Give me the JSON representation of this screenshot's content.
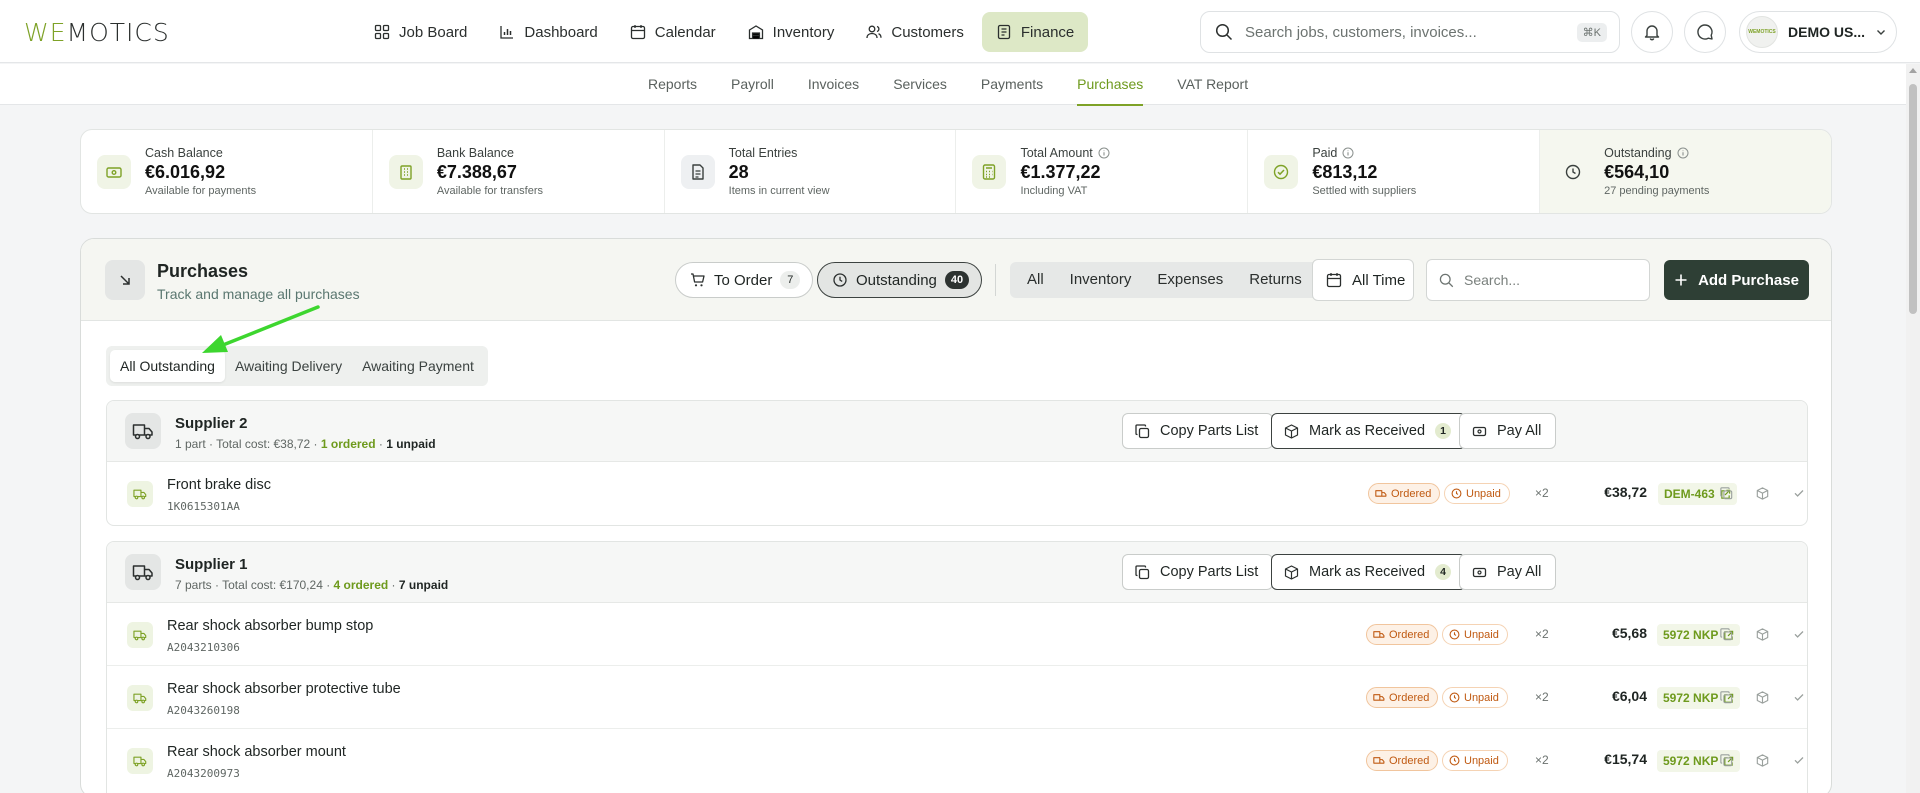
{
  "brand": {
    "logo_prefix": "WE",
    "logo_suffix": "MOTICS",
    "accent": "#7ea227",
    "dark_button": "#2e3f35"
  },
  "nav": {
    "items": [
      {
        "label": "Job Board",
        "icon": "grid-icon"
      },
      {
        "label": "Dashboard",
        "icon": "bar-chart-icon"
      },
      {
        "label": "Calendar",
        "icon": "calendar-icon"
      },
      {
        "label": "Inventory",
        "icon": "warehouse-icon"
      },
      {
        "label": "Customers",
        "icon": "users-icon"
      },
      {
        "label": "Finance",
        "icon": "receipt-icon",
        "active": true
      }
    ]
  },
  "search": {
    "placeholder": "Search jobs, customers, invoices...",
    "shortcut": "⌘K"
  },
  "user": {
    "name": "DEMO US...",
    "avatar_text": "WEMOTICS"
  },
  "subnav": {
    "items": [
      "Reports",
      "Payroll",
      "Invoices",
      "Services",
      "Payments",
      "Purchases",
      "VAT Report"
    ],
    "active": "Purchases"
  },
  "stats": [
    {
      "label": "Cash Balance",
      "value": "€6.016,92",
      "sub": "Available for payments",
      "icon": "cash-icon"
    },
    {
      "label": "Bank Balance",
      "value": "€7.388,67",
      "sub": "Available for transfers",
      "icon": "bank-icon"
    },
    {
      "label": "Total Entries",
      "value": "28",
      "sub": "Items in current view",
      "icon": "document-icon"
    },
    {
      "label": "Total Amount",
      "value": "€1.377,22",
      "sub": "Including VAT",
      "icon": "calculator-icon",
      "info": true
    },
    {
      "label": "Paid",
      "value": "€813,12",
      "sub": "Settled with suppliers",
      "icon": "check-circle-icon",
      "info": true
    },
    {
      "label": "Outstanding",
      "value": "€564,10",
      "sub": "27 pending payments",
      "icon": "clock-icon",
      "info": true
    }
  ],
  "purchases": {
    "title": "Purchases",
    "subtitle": "Track and manage all purchases",
    "filters": [
      {
        "label": "To Order",
        "count": "7"
      },
      {
        "label": "Outstanding",
        "count": "40",
        "active": true
      }
    ],
    "types": [
      "All",
      "Inventory",
      "Expenses",
      "Returns"
    ],
    "time_filter": "All Time",
    "search_placeholder": "Search...",
    "add_label": "Add Purchase",
    "subtabs": [
      "All Outstanding",
      "Awaiting Delivery",
      "Awaiting Payment"
    ],
    "active_subtab": "All Outstanding"
  },
  "group_actions": {
    "copy": "Copy Parts List",
    "received": "Mark as Received",
    "pay": "Pay All"
  },
  "badges": {
    "ordered": "Ordered",
    "unpaid": "Unpaid"
  },
  "suppliers": [
    {
      "name": "Supplier 2",
      "meta_prefix": "1 part · Total cost: €38,72 · ",
      "ordered": "1 ordered",
      "sep": " · ",
      "unpaid": "1 unpaid",
      "received_count": "1",
      "items": [
        {
          "name": "Front brake disc",
          "code": "1K0615301AA",
          "qty": "×2",
          "price": "€38,72",
          "ref": "DEM-463"
        }
      ]
    },
    {
      "name": "Supplier 1",
      "meta_prefix": "7 parts · Total cost: €170,24 · ",
      "ordered": "4 ordered",
      "sep": " · ",
      "unpaid": "7 unpaid",
      "received_count": "4",
      "items": [
        {
          "name": "Rear shock absorber bump stop",
          "code": "A2043210306",
          "qty": "×2",
          "price": "€5,68",
          "ref": "5972 NKP"
        },
        {
          "name": "Rear shock absorber protective tube",
          "code": "A2043260198",
          "qty": "×2",
          "price": "€6,04",
          "ref": "5972 NKP"
        },
        {
          "name": "Rear shock absorber mount",
          "code": "A2043200973",
          "qty": "×2",
          "price": "€15,74",
          "ref": "5972 NKP"
        }
      ]
    }
  ],
  "annotation": {
    "color": "#3dd62f",
    "target": "All Outstanding"
  }
}
